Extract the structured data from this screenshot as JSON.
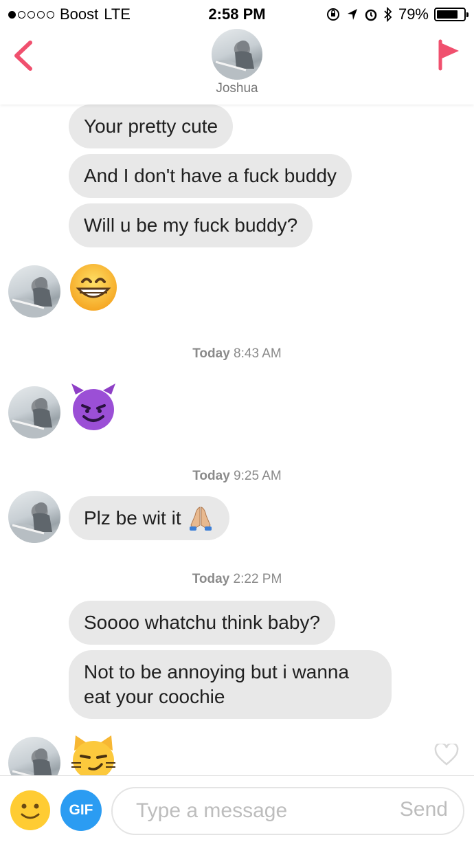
{
  "status_bar": {
    "carrier": "Boost",
    "network": "LTE",
    "time": "2:58 PM",
    "battery": "79%",
    "battery_level": 0.79,
    "signal_dots_filled": 1,
    "signal_dots_total": 5
  },
  "header": {
    "contact_name": "Joshua",
    "accent_color": "#f0506e"
  },
  "messages": [
    {
      "type": "text",
      "text": "Your pretty cute"
    },
    {
      "type": "text",
      "text": "And I don't have a fuck buddy"
    },
    {
      "type": "text",
      "text": "Will u be my fuck buddy?"
    },
    {
      "type": "emoji",
      "emoji": "grinning-face-emoji"
    },
    {
      "type": "timestamp",
      "day": "Today",
      "time": "8:43 AM"
    },
    {
      "type": "emoji",
      "emoji": "smiling-devil-emoji"
    },
    {
      "type": "timestamp",
      "day": "Today",
      "time": "9:25 AM"
    },
    {
      "type": "text",
      "text": "Plz be wit it",
      "emoji": "folded-hands-emoji"
    },
    {
      "type": "timestamp",
      "day": "Today",
      "time": "2:22 PM"
    },
    {
      "type": "text",
      "text": "Soooo whatchu think baby?"
    },
    {
      "type": "text",
      "text": "Not to be annoying but i wanna eat your coochie"
    },
    {
      "type": "emoji",
      "emoji": "smirking-cat-emoji"
    }
  ],
  "input_bar": {
    "gif_label": "GIF",
    "placeholder": "Type a message",
    "send_label": "Send",
    "gif_color": "#2b9cf2"
  }
}
